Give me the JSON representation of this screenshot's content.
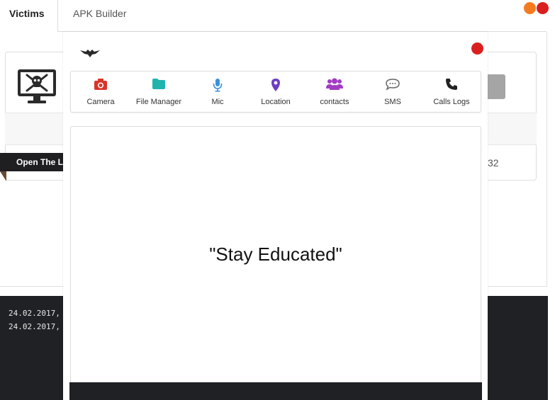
{
  "tabs": [
    {
      "label": "Victims",
      "active": true
    },
    {
      "label": "APK Builder",
      "active": false
    }
  ],
  "window_controls": {
    "minimize_color": "#f47c20",
    "close_color": "#d9201f"
  },
  "victims_panel": {
    "banner_text": "Open The La",
    "row_partial_text": "32",
    "icon": "skull-monitor-icon"
  },
  "console": {
    "lines": [
      "24.02.2017,",
      "24.02.2017,"
    ]
  },
  "popup": {
    "logo_icon": "bird-logo-icon",
    "close_color": "#d9201f",
    "toolbar": [
      {
        "label": "Camera",
        "icon": "camera-icon",
        "color": "#d9342b"
      },
      {
        "label": "File Manager",
        "icon": "folder-icon",
        "color": "#1fb5ad"
      },
      {
        "label": "Mic",
        "icon": "microphone-icon",
        "color": "#3b8fd9"
      },
      {
        "label": "Location",
        "icon": "map-pin-icon",
        "color": "#6f3cc4"
      },
      {
        "label": "contacts",
        "icon": "users-icon",
        "color": "#a23cc4"
      },
      {
        "label": "SMS",
        "icon": "chat-bubble-icon",
        "color": "#666666"
      },
      {
        "label": "Calls Logs",
        "icon": "phone-icon",
        "color": "#222222"
      }
    ],
    "motto": "\"Stay Educated\""
  }
}
